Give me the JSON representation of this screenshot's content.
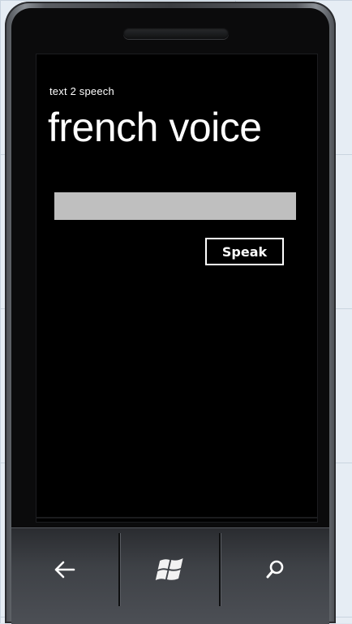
{
  "app": {
    "app_title": "text 2 speech",
    "page_title": "french voice"
  },
  "form": {
    "input_value": "",
    "speak_label": "Speak"
  },
  "nav": {
    "back_icon": "back-arrow-icon",
    "start_icon": "windows-logo-icon",
    "search_icon": "search-icon"
  },
  "colors": {
    "screen_background": "#000000",
    "text": "#ffffff",
    "input_background": "#bfbfbf"
  }
}
